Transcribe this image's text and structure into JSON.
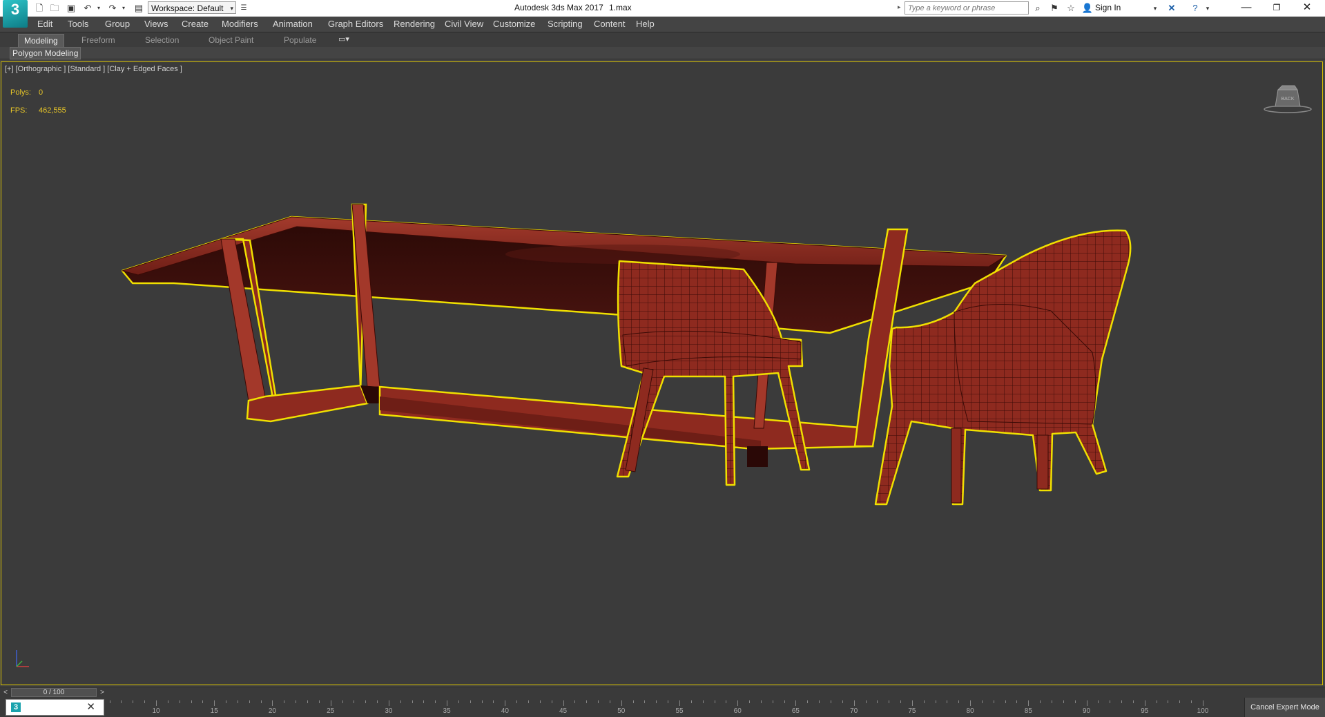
{
  "app": {
    "logo_text": "3",
    "title": "Autodesk 3ds Max 2017",
    "file_name": "1.max",
    "workspace_label": "Workspace: Default"
  },
  "search": {
    "placeholder": "Type a keyword or phrase"
  },
  "account": {
    "sign_in_label": "Sign In"
  },
  "menu": [
    "Edit",
    "Tools",
    "Group",
    "Views",
    "Create",
    "Modifiers",
    "Animation",
    "Graph Editors",
    "Rendering",
    "Civil View",
    "Customize",
    "Scripting",
    "Content",
    "Help"
  ],
  "ribbon": {
    "tabs": [
      "Modeling",
      "Freeform",
      "Selection",
      "Object Paint",
      "Populate"
    ],
    "active_tab": "Modeling",
    "panel_label": "Polygon Modeling"
  },
  "viewport": {
    "label": "[+] [Orthographic ] [Standard ] [Clay + Edged Faces ]",
    "stats": {
      "polys_label": "Polys:",
      "polys_value": "0",
      "fps_label": "FPS:",
      "fps_value": "462,555"
    },
    "viewcube_label": "BACK"
  },
  "timeline": {
    "slider_label": "0 / 100",
    "ticks": [
      "10",
      "15",
      "20",
      "25",
      "30",
      "35",
      "40",
      "45",
      "50",
      "55",
      "60",
      "65",
      "70",
      "75",
      "80",
      "85",
      "90",
      "95",
      "100"
    ]
  },
  "status": {
    "cancel_expert_mode": "Cancel Expert Mode"
  },
  "colors": {
    "selection_outline": "#f0e000",
    "model_fill": "#8a2a1f",
    "viewport_bg": "#3b3b3b",
    "accent": "#1aa3ad"
  }
}
